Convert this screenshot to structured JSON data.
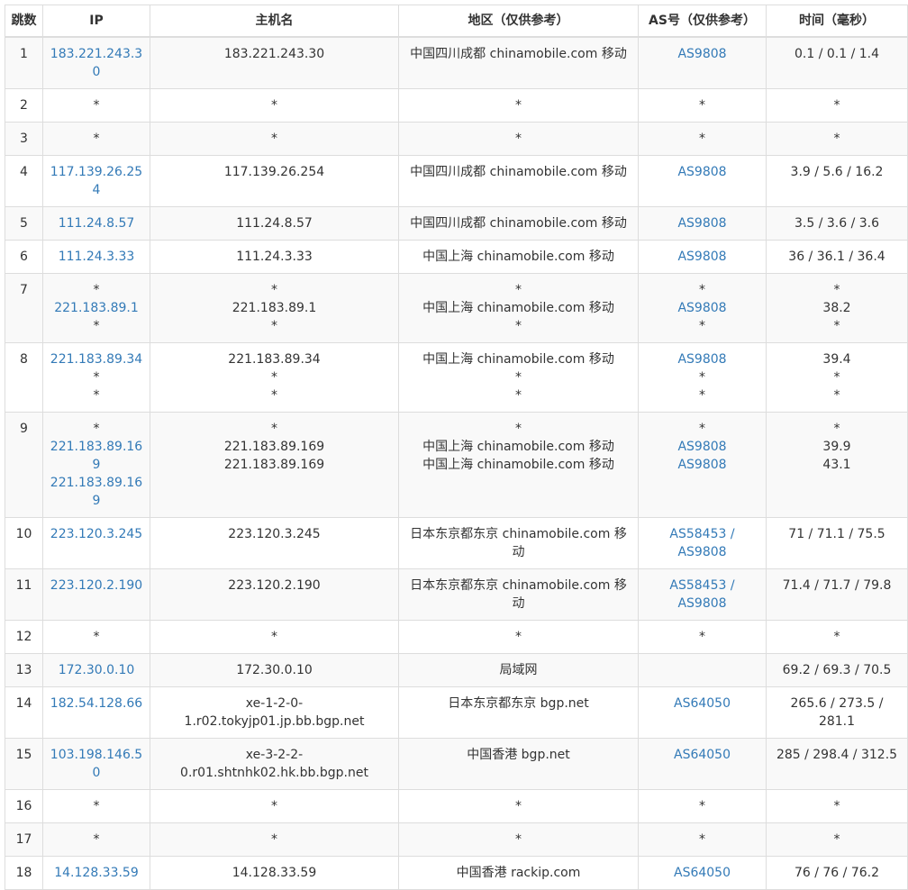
{
  "headers": [
    "跳数",
    "IP",
    "主机名",
    "地区（仅供参考）",
    "AS号（仅供参考）",
    "时间（毫秒）"
  ],
  "rows": [
    {
      "hop": "1",
      "ip": [
        "183.221.243.30"
      ],
      "host": [
        "183.221.243.30"
      ],
      "region": [
        "中国四川成都 chinamobile.com 移动"
      ],
      "as": [
        "AS9808"
      ],
      "time": [
        "0.1 / 0.1 / 1.4"
      ]
    },
    {
      "hop": "2",
      "ip": [
        "*"
      ],
      "host": [
        "*"
      ],
      "region": [
        "*"
      ],
      "as": [
        "*"
      ],
      "time": [
        "*"
      ]
    },
    {
      "hop": "3",
      "ip": [
        "*"
      ],
      "host": [
        "*"
      ],
      "region": [
        "*"
      ],
      "as": [
        "*"
      ],
      "time": [
        "*"
      ]
    },
    {
      "hop": "4",
      "ip": [
        "117.139.26.254"
      ],
      "host": [
        "117.139.26.254"
      ],
      "region": [
        "中国四川成都 chinamobile.com 移动"
      ],
      "as": [
        "AS9808"
      ],
      "time": [
        "3.9 / 5.6 / 16.2"
      ]
    },
    {
      "hop": "5",
      "ip": [
        "111.24.8.57"
      ],
      "host": [
        "111.24.8.57"
      ],
      "region": [
        "中国四川成都 chinamobile.com 移动"
      ],
      "as": [
        "AS9808"
      ],
      "time": [
        "3.5 / 3.6 / 3.6"
      ]
    },
    {
      "hop": "6",
      "ip": [
        "111.24.3.33"
      ],
      "host": [
        "111.24.3.33"
      ],
      "region": [
        "中国上海 chinamobile.com 移动"
      ],
      "as": [
        "AS9808"
      ],
      "time": [
        "36 / 36.1 / 36.4"
      ]
    },
    {
      "hop": "7",
      "ip": [
        "*",
        "221.183.89.1",
        "*"
      ],
      "host": [
        "*",
        "221.183.89.1",
        "*"
      ],
      "region": [
        "*",
        "中国上海 chinamobile.com 移动",
        "*"
      ],
      "as": [
        "*",
        "AS9808",
        "*"
      ],
      "time": [
        "*",
        "38.2",
        "*"
      ]
    },
    {
      "hop": "8",
      "ip": [
        "221.183.89.34",
        "*",
        "*"
      ],
      "host": [
        "221.183.89.34",
        "*",
        "*"
      ],
      "region": [
        "中国上海 chinamobile.com 移动",
        "*",
        "*"
      ],
      "as": [
        "AS9808",
        "*",
        "*"
      ],
      "time": [
        "39.4",
        "*",
        "*"
      ]
    },
    {
      "hop": "9",
      "ip": [
        "*",
        "221.183.89.169",
        "221.183.89.169"
      ],
      "host": [
        "*",
        "221.183.89.169",
        "221.183.89.169"
      ],
      "region": [
        "*",
        "中国上海 chinamobile.com 移动",
        "中国上海 chinamobile.com 移动"
      ],
      "as": [
        "*",
        "AS9808",
        "AS9808"
      ],
      "time": [
        "*",
        "39.9",
        "43.1"
      ]
    },
    {
      "hop": "10",
      "ip": [
        "223.120.3.245"
      ],
      "host": [
        "223.120.3.245"
      ],
      "region": [
        "日本东京都东京 chinamobile.com 移动"
      ],
      "as": [
        "AS58453 / AS9808"
      ],
      "time": [
        "71 / 71.1 / 75.5"
      ]
    },
    {
      "hop": "11",
      "ip": [
        "223.120.2.190"
      ],
      "host": [
        "223.120.2.190"
      ],
      "region": [
        "日本东京都东京 chinamobile.com 移动"
      ],
      "as": [
        "AS58453 / AS9808"
      ],
      "time": [
        "71.4 / 71.7 / 79.8"
      ]
    },
    {
      "hop": "12",
      "ip": [
        "*"
      ],
      "host": [
        "*"
      ],
      "region": [
        "*"
      ],
      "as": [
        "*"
      ],
      "time": [
        "*"
      ]
    },
    {
      "hop": "13",
      "ip": [
        "172.30.0.10"
      ],
      "host": [
        "172.30.0.10"
      ],
      "region": [
        "局域网"
      ],
      "as": [
        ""
      ],
      "time": [
        "69.2 / 69.3 / 70.5"
      ]
    },
    {
      "hop": "14",
      "ip": [
        "182.54.128.66"
      ],
      "host": [
        "xe-1-2-0-1.r02.tokyjp01.jp.bb.bgp.net"
      ],
      "region": [
        "日本东京都东京 bgp.net"
      ],
      "as": [
        "AS64050"
      ],
      "time": [
        "265.6 / 273.5 / 281.1"
      ]
    },
    {
      "hop": "15",
      "ip": [
        "103.198.146.50"
      ],
      "host": [
        "xe-3-2-2-0.r01.shtnhk02.hk.bb.bgp.net"
      ],
      "region": [
        "中国香港 bgp.net"
      ],
      "as": [
        "AS64050"
      ],
      "time": [
        "285 / 298.4 / 312.5"
      ]
    },
    {
      "hop": "16",
      "ip": [
        "*"
      ],
      "host": [
        "*"
      ],
      "region": [
        "*"
      ],
      "as": [
        "*"
      ],
      "time": [
        "*"
      ]
    },
    {
      "hop": "17",
      "ip": [
        "*"
      ],
      "host": [
        "*"
      ],
      "region": [
        "*"
      ],
      "as": [
        "*"
      ],
      "time": [
        "*"
      ]
    },
    {
      "hop": "18",
      "ip": [
        "14.128.33.59"
      ],
      "host": [
        "14.128.33.59"
      ],
      "region": [
        "中国香港 rackip.com"
      ],
      "as": [
        "AS64050"
      ],
      "time": [
        "76 / 76 / 76.2"
      ]
    }
  ]
}
